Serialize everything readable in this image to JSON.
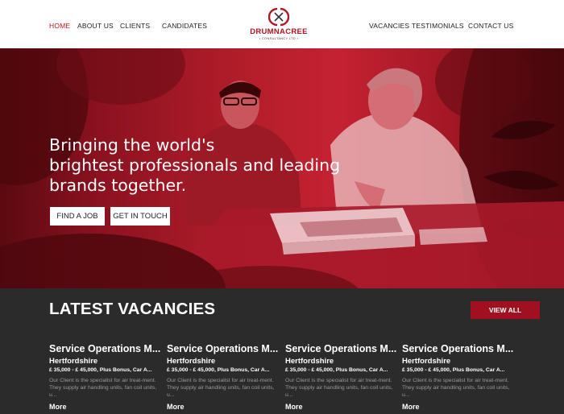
{
  "nav": {
    "left": [
      {
        "label": "HOME",
        "active": true
      },
      {
        "label": "ABOUT US",
        "active": false
      },
      {
        "label": "CLIENTS",
        "active": false
      },
      {
        "label": "CANDIDATES",
        "active": false
      }
    ],
    "right": [
      {
        "label": "VACANCIES",
        "active": false
      },
      {
        "label": "TESTIMONIALS",
        "active": false
      },
      {
        "label": "CONTACT US",
        "active": false
      }
    ],
    "logo": {
      "name": "DRUMNACREE",
      "sub": "• CONSULTANCY LTD •"
    }
  },
  "hero": {
    "lines": [
      "Bringing the world's",
      "brightest professionals and leading",
      "brands together."
    ],
    "buttons": [
      "FIND A JOB",
      "GET IN TOUCH"
    ]
  },
  "vacancies": {
    "title": "LATEST VACANCIES",
    "view_all": "VIEW ALL",
    "items": [
      {
        "title": "Service Operations M...",
        "location": "Hertfordshire",
        "salary": "£ 35,000 - £ 45,000, Plus Bonus, Car A...",
        "description": "Our Client is the specialist for air treat-ment. They supply air handling units, fan coil units, u...",
        "more": "More"
      },
      {
        "title": "Service Operations M...",
        "location": "Hertfordshire",
        "salary": "£ 35,000 - £ 45,000, Plus Bonus, Car A...",
        "description": "Our Client is the specialist for air treat-ment. They supply air handling units, fan coil units, u...",
        "more": "More"
      },
      {
        "title": "Service Operations M...",
        "location": "Hertfordshire",
        "salary": "£ 35,000 - £ 45,000, Plus Bonus, Car A...",
        "description": "Our Client is the specialist for air treat-ment. They supply air handling units, fan coil units, u...",
        "more": "More"
      },
      {
        "title": "Service Operations M...",
        "location": "Hertfordshire",
        "salary": "£ 35,000 - £ 45,000, Plus Bonus, Car A...",
        "description": "Our Client is the specialist for air treat-ment. They supply air handling units, fan coil units, u...",
        "more": "More"
      }
    ]
  },
  "colors": {
    "brand_red": "#c2121b",
    "button_red": "#a01020",
    "dark_bg": "#2b2b2b"
  }
}
